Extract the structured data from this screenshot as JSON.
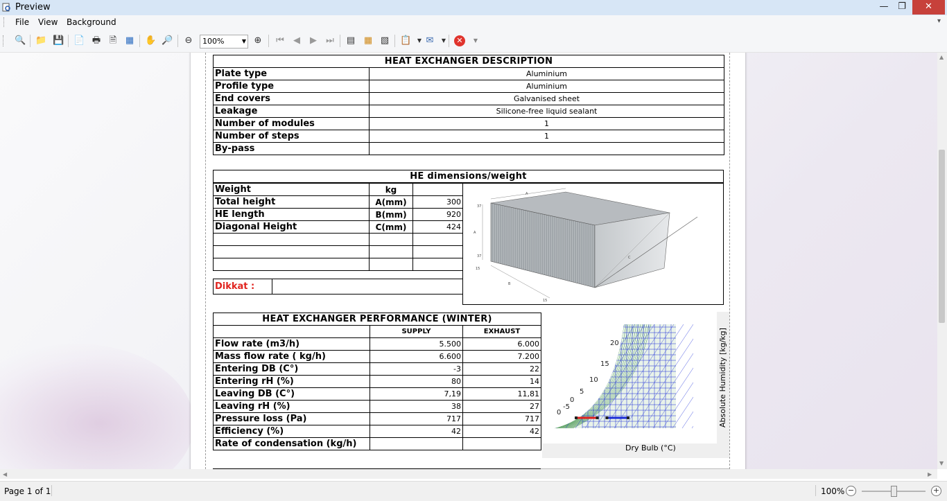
{
  "window": {
    "title": "Preview"
  },
  "menu": {
    "file": "File",
    "view": "View",
    "background": "Background"
  },
  "toolbar": {
    "zoom_value": "100%",
    "icons": [
      "find-icon",
      "open-icon",
      "save-icon",
      "page-setup-icon",
      "print-icon",
      "quick-print-icon",
      "export-icon",
      "hand-tool-icon",
      "magnifier-icon",
      "zoom-out-icon",
      "zoom-in-icon",
      "first-page-icon",
      "previous-page-icon",
      "next-page-icon",
      "last-page-icon",
      "multiple-pages-icon",
      "color-icon",
      "watermark-icon",
      "export-document-icon",
      "send-email-icon",
      "close-preview-icon"
    ]
  },
  "report": {
    "heat_exchanger_description": {
      "title": "HEAT EXCHANGER DESCRIPTION",
      "rows": [
        {
          "label": "Plate type",
          "value": "Aluminium"
        },
        {
          "label": "Profile type",
          "value": "Aluminium"
        },
        {
          "label": "End covers",
          "value": "Galvanised sheet"
        },
        {
          "label": "Leakage",
          "value": "Silicone-free liquid sealant"
        },
        {
          "label": "Number of modules",
          "value": "1"
        },
        {
          "label": "Number of steps",
          "value": "1"
        },
        {
          "label": "By-pass",
          "value": ""
        }
      ]
    },
    "dimensions": {
      "title": "HE dimensions/weight",
      "rows": [
        {
          "label": "Weight",
          "unit": "kg",
          "value": ""
        },
        {
          "label": "Total height",
          "unit": "A(mm)",
          "value": "300"
        },
        {
          "label": "HE length",
          "unit": "B(mm)",
          "value": "920"
        },
        {
          "label": "Diagonal Height",
          "unit": "C(mm)",
          "value": "424"
        }
      ],
      "notice_label": "Dikkat :",
      "notice_value": ""
    },
    "performance": {
      "title": "HEAT EXCHANGER PERFORMANCE (WINTER)",
      "col_supply": "SUPPLY",
      "col_exhaust": "EXHAUST",
      "rows": [
        {
          "label": "Flow rate (m3/h)",
          "supply": "5.500",
          "exhaust": "6.000"
        },
        {
          "label": "Mass flow rate ( kg/h)",
          "supply": "6.600",
          "exhaust": "7.200"
        },
        {
          "label": "Entering DB (C°)",
          "supply": "-3",
          "exhaust": "22"
        },
        {
          "label": "Entering rH (%)",
          "supply": "80",
          "exhaust": "14"
        },
        {
          "label": "Leaving DB (C°)",
          "supply": "7,19",
          "exhaust": "11,81"
        },
        {
          "label": "Leaving rH (%)",
          "supply": "38",
          "exhaust": "27"
        },
        {
          "label": "Pressure loss (Pa)",
          "supply": "717",
          "exhaust": "717"
        },
        {
          "label": "Efficiency (%)",
          "supply": "42",
          "exhaust": "42"
        },
        {
          "label": "Rate of condensation (kg/h)",
          "supply": "",
          "exhaust": ""
        }
      ]
    },
    "psychro_chart": {
      "xlabel": "Dry Bulb (°C)",
      "ylabel": "Absolute Humidity [kg/kg]",
      "curve_labels": [
        "20",
        "15",
        "10",
        "5",
        "0",
        "-5",
        "0"
      ]
    }
  },
  "chart_data": {
    "type": "scatter",
    "xlabel": "Dry Bulb (°C)",
    "ylabel": "Absolute Humidity [kg/kg]",
    "curve_labels": [
      "-5",
      "0",
      "5",
      "10",
      "15",
      "20"
    ],
    "series": [
      {
        "name": "",
        "x": [
          -3,
          7.19
        ],
        "color": "#e02020"
      },
      {
        "name": "",
        "x": [
          22,
          11.81
        ],
        "color": "#1a2bd8"
      }
    ]
  },
  "status": {
    "page": "Page 1 of 1",
    "zoom": "100%"
  }
}
